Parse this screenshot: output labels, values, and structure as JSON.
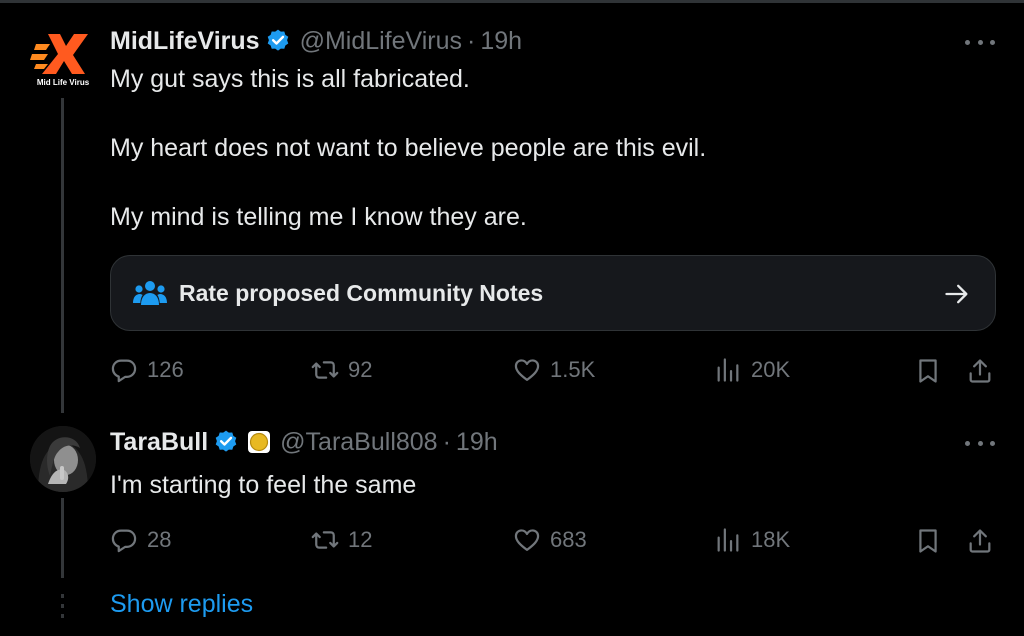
{
  "tweets": [
    {
      "author": {
        "display_name": "MidLifeVirus",
        "handle": "@MidLifeVirus",
        "avatar_text": "Mid Life Virus",
        "verified": true
      },
      "time": "19h",
      "lines": [
        "My gut says this is all fabricated.",
        "My heart does not want to believe people are this evil.",
        "My mind is telling me I know they are."
      ],
      "community_notes_label": "Rate proposed Community Notes",
      "stats": {
        "replies": "126",
        "reposts": "92",
        "likes": "1.5K",
        "views": "20K"
      }
    },
    {
      "author": {
        "display_name": "TaraBull",
        "handle": "@TaraBull808",
        "verified": true
      },
      "time": "19h",
      "lines": [
        "I'm starting to feel the same"
      ],
      "stats": {
        "replies": "28",
        "reposts": "12",
        "likes": "683",
        "views": "18K"
      }
    }
  ],
  "separator": "·",
  "show_replies_label": "Show replies",
  "colors": {
    "background": "#000000",
    "text": "#e7e9ea",
    "muted": "#71767b",
    "accent": "#1d9bf0",
    "verified": "#1d9bf0",
    "logo_orange": "#ff5a1f"
  },
  "icons": [
    "verified-badge-icon",
    "community-notes-icon",
    "arrow-right-icon",
    "reply-icon",
    "repost-icon",
    "like-icon",
    "views-icon",
    "bookmark-icon",
    "share-icon",
    "more-icon",
    "affiliate-coin-icon"
  ]
}
